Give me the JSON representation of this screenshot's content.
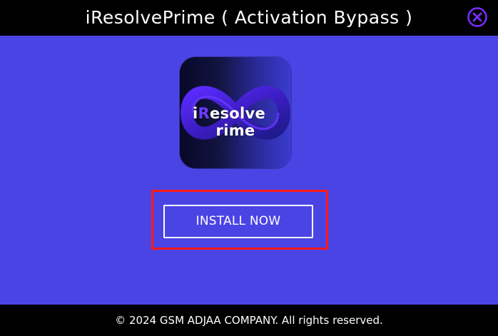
{
  "window": {
    "title": "iResolvePrime ( Activation Bypass )",
    "close_icon": "close-circle-icon",
    "accent_color": "#7b2cff",
    "background_color": "#4b44e4",
    "bar_color": "#000000"
  },
  "logo": {
    "text_start": "i",
    "text_accent": "R",
    "text_mid": "esolve",
    "text_end": "rime"
  },
  "actions": {
    "install_label": "INSTALL NOW",
    "highlight_color": "#ff1a1a"
  },
  "footer": {
    "copyright": "© 2024 GSM ADJAA COMPANY. All rights reserved."
  }
}
